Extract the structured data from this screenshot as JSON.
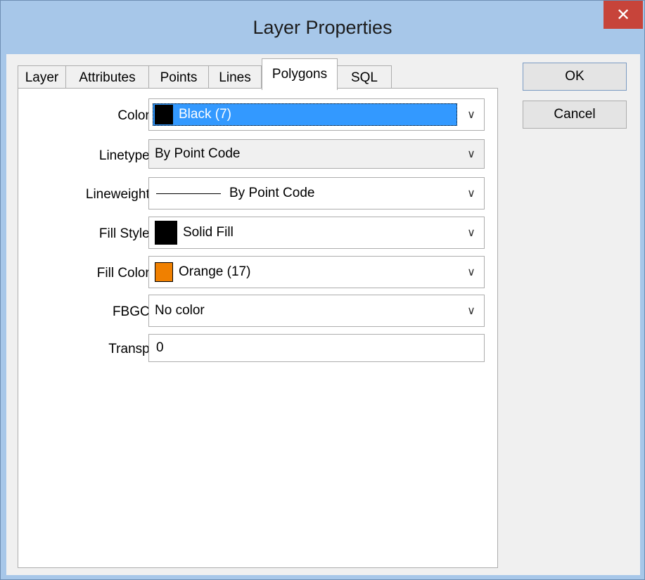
{
  "window": {
    "title": "Layer Properties",
    "close_glyph": "✕"
  },
  "tabs": [
    {
      "label": "Layer",
      "active": false
    },
    {
      "label": "Attributes",
      "active": false
    },
    {
      "label": "Points",
      "active": false
    },
    {
      "label": "Lines",
      "active": false
    },
    {
      "label": "Polygons",
      "active": true
    },
    {
      "label": "SQL",
      "active": false
    }
  ],
  "fields": {
    "color": {
      "label": "Color:",
      "value": "Black (7)",
      "swatch": "#000000"
    },
    "linetype": {
      "label": "Linetype:",
      "value": "By Point Code"
    },
    "lineweight": {
      "label": "Lineweight:",
      "value": "By Point Code"
    },
    "fill_style": {
      "label": "Fill Style:",
      "value": "Solid Fill",
      "swatch": "#000000"
    },
    "fill_color": {
      "label": "Fill Color:",
      "value": "Orange (17)",
      "swatch": "#f08000"
    },
    "fbgc": {
      "label": "FBGC:",
      "value": "No color"
    },
    "transp": {
      "label": "Transp:",
      "value": "0"
    }
  },
  "buttons": {
    "ok": "OK",
    "cancel": "Cancel"
  },
  "icons": {
    "dropdown": "chevron-down-icon",
    "close": "close-icon"
  },
  "colors": {
    "title_bar": "#a7c7e9",
    "close_button": "#c7443a",
    "selection": "#3399ff"
  }
}
